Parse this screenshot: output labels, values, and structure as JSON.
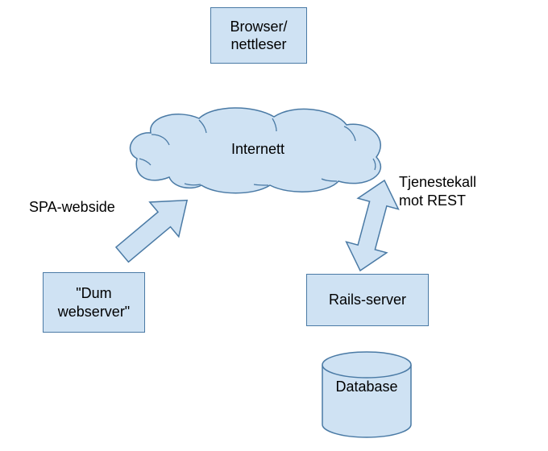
{
  "nodes": {
    "browser": "Browser/\nnettleser",
    "internet": "Internett",
    "webserver": "\"Dum\nwebserver\"",
    "rails": "Rails-server",
    "database": "Database"
  },
  "labels": {
    "spa": "SPA-webside",
    "rest": "Tjenestekall\nmot REST"
  },
  "colors": {
    "fill": "#cfe2f3",
    "stroke": "#4a7aa5"
  }
}
